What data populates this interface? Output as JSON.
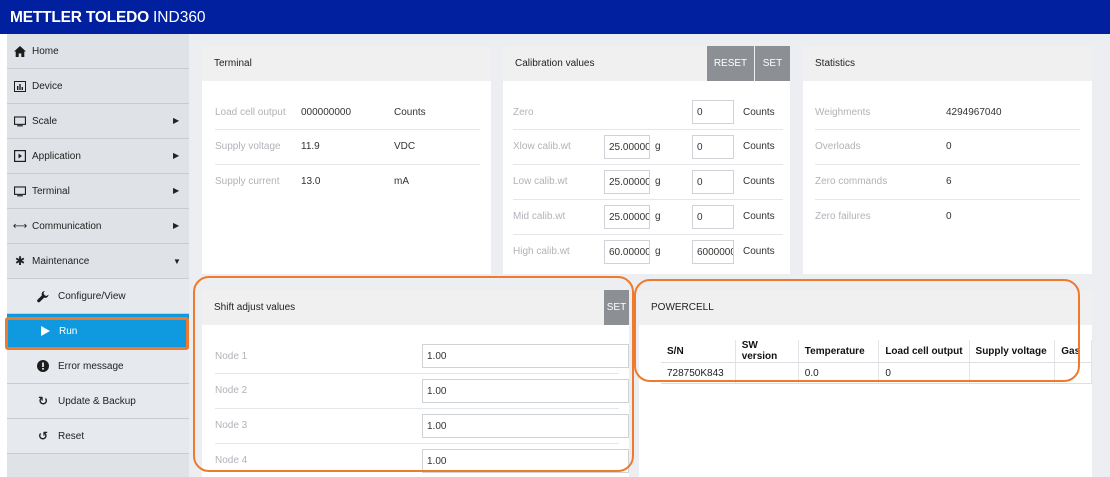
{
  "app": {
    "brand": "METTLER TOLEDO",
    "model": "IND360"
  },
  "colors": {
    "topbar": "#00209f",
    "active_nav": "#0f9adf",
    "highlight": "#ef7a2d",
    "button": "#8c8f94"
  },
  "sidebar": {
    "items": [
      {
        "label": "Home",
        "icon": "home-icon"
      },
      {
        "label": "Device",
        "icon": "device-icon"
      },
      {
        "label": "Scale",
        "icon": "monitor-icon",
        "expand": "collapsed"
      },
      {
        "label": "Application",
        "icon": "application-icon",
        "expand": "collapsed"
      },
      {
        "label": "Terminal",
        "icon": "monitor-icon",
        "expand": "collapsed"
      },
      {
        "label": "Communication",
        "icon": "arrows-icon",
        "expand": "collapsed"
      },
      {
        "label": "Maintenance",
        "icon": "gear-icon",
        "expand": "expanded"
      }
    ],
    "subitems": [
      {
        "label": "Configure/View",
        "icon": "wrench-icon"
      },
      {
        "label": "Run",
        "icon": "play-icon",
        "active": true
      },
      {
        "label": "Error message",
        "icon": "alert-icon"
      },
      {
        "label": "Update & Backup",
        "icon": "refresh-icon"
      },
      {
        "label": "Reset",
        "icon": "reset-icon"
      }
    ]
  },
  "terminal": {
    "title": "Terminal",
    "rows": [
      {
        "label": "Load cell output",
        "value": "000000000",
        "unit": "Counts"
      },
      {
        "label": "Supply voltage",
        "value": "11.9",
        "unit": "VDC"
      },
      {
        "label": "Supply current",
        "value": "13.0",
        "unit": "mA"
      }
    ]
  },
  "calibration": {
    "title": "Calibration values",
    "reset_label": "RESET",
    "set_label": "SET",
    "zero": {
      "label": "Zero",
      "counts": "0",
      "unit": "Counts"
    },
    "rows": [
      {
        "label": "Xlow calib.wt",
        "weight": "25.00000",
        "weight_unit": "g",
        "counts": "0",
        "unit": "Counts"
      },
      {
        "label": "Low calib.wt",
        "weight": "25.00000",
        "weight_unit": "g",
        "counts": "0",
        "unit": "Counts"
      },
      {
        "label": "Mid calib.wt",
        "weight": "25.00000",
        "weight_unit": "g",
        "counts": "0",
        "unit": "Counts"
      },
      {
        "label": "High calib.wt",
        "weight": "60.00000",
        "weight_unit": "g",
        "counts": "6000000",
        "unit": "Counts"
      }
    ]
  },
  "statistics": {
    "title": "Statistics",
    "rows": [
      {
        "label": "Weighments",
        "value": "4294967040"
      },
      {
        "label": "Overloads",
        "value": "0"
      },
      {
        "label": "Zero commands",
        "value": "6"
      },
      {
        "label": "Zero failures",
        "value": "0"
      }
    ]
  },
  "shift_adjust": {
    "title": "Shift adjust values",
    "set_label": "SET",
    "rows": [
      {
        "label": "Node 1",
        "value": "1.00"
      },
      {
        "label": "Node 2",
        "value": "1.00"
      },
      {
        "label": "Node 3",
        "value": "1.00"
      },
      {
        "label": "Node 4",
        "value": "1.00"
      }
    ]
  },
  "powercell": {
    "title": "POWERCELL",
    "columns": [
      "S/N",
      "SW version",
      "Temperature",
      "Load cell output",
      "Supply voltage",
      "Gas"
    ],
    "rows": [
      [
        "728750K843",
        "",
        "0.0",
        "0",
        "",
        ""
      ]
    ]
  }
}
